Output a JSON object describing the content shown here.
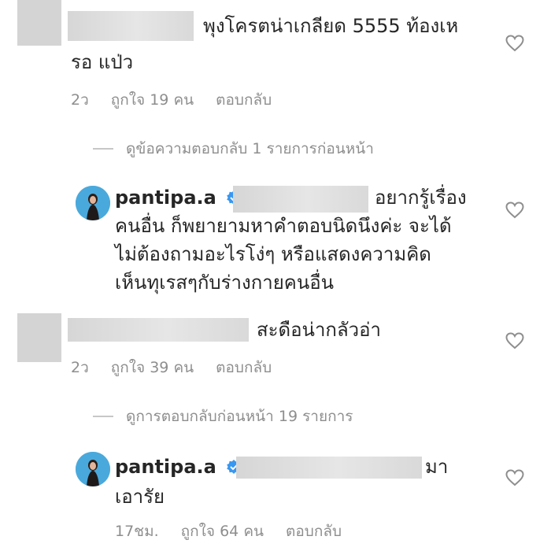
{
  "comments": [
    {
      "text_line1": "พุงโครตน่าเกลียด 5555 ท้องเห",
      "text_line2": "รอ แป่ว",
      "time": "2ว",
      "likes": "ถูกใจ 19 คน",
      "reply": "ตอบกลับ"
    },
    {
      "view_replies": "ดูข้อความตอบกลับ 1 รายการก่อนหน้า"
    },
    {
      "username": "pantipa.a",
      "text_line1": "อยากรู้เรื่อง",
      "text_line2": "คนอื่น ก็พยายามหาคำตอบนิดนึงค่ะ จะได้",
      "text_line3": "ไม่ต้องถามอะไรโง่ๆ หรือแสดงความคิด",
      "text_line4": "เห็นทุเรสๆกับร่างกายคนอื่น"
    },
    {
      "text_line1": "สะดือน่ากลัวอ่า",
      "time": "2ว",
      "likes": "ถูกใจ 39 คน",
      "reply": "ตอบกลับ"
    },
    {
      "view_replies": "ดูการตอบกลับก่อนหน้า 19 รายการ"
    },
    {
      "username": "pantipa.a",
      "text_line1": "มา",
      "text_line2": "เอารัย",
      "time": "17ชม.",
      "likes": "ถูกใจ 64 คน",
      "reply": "ตอบกลับ"
    }
  ],
  "icons": {
    "heart": "heart-outline-icon",
    "verified": "verified-badge-icon"
  },
  "colors": {
    "text": "#262626",
    "muted": "#8e8e8e",
    "verified": "#3897f0"
  }
}
